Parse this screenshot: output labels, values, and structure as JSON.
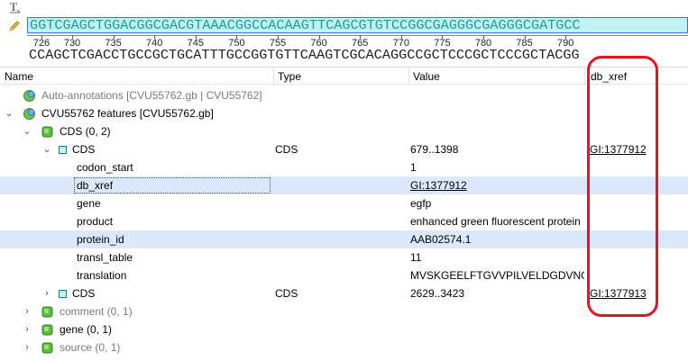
{
  "sequence": {
    "forward": "GGTCGAGCTGGACGGCGACGTAAACGGCCACAAGTTCAGCGTGTCCGGCGAGGGCGAGGGCGATGCC",
    "complement": "CCAGCTCGACCTGCCGCTGCATTTGCCGGTGTTCAAGTCGCACAGGCCGCTCCCGCTCCCGCTACGG",
    "ruler_labels": [
      "726",
      "730",
      "735",
      "740",
      "745",
      "750",
      "755",
      "760",
      "765",
      "770",
      "775",
      "780",
      "785",
      "790"
    ]
  },
  "columns": {
    "name": "Name",
    "type": "Type",
    "value": "Value",
    "db_xref": "db_xref"
  },
  "tree": {
    "auto_annotations": "Auto-annotations [CVU55762.gb | CVU55762]",
    "features": "CVU55762 features [CVU55762.gb]",
    "cds_group": "CDS  (0, 2)",
    "cds1": {
      "name": "CDS",
      "type": "CDS",
      "value": "679..1398",
      "db_xref": "GI:1377912"
    },
    "qualifiers": [
      {
        "name": "codon_start",
        "value": "1"
      },
      {
        "name": "db_xref",
        "value": "GI:1377912"
      },
      {
        "name": "gene",
        "value": "egfp"
      },
      {
        "name": "product",
        "value": "enhanced green fluorescent protein"
      },
      {
        "name": "protein_id",
        "value": "AAB02574.1"
      },
      {
        "name": "transl_table",
        "value": "11"
      },
      {
        "name": "translation",
        "value": "MVSKGEELFTGVVPILVELDGDVNGH..."
      }
    ],
    "cds2": {
      "name": "CDS",
      "type": "CDS",
      "value": "2629..3423",
      "db_xref": "GI:1377913"
    },
    "comment": "comment  (0, 1)",
    "gene": "gene  (0, 1)",
    "source": "source  (0, 1)"
  },
  "colors": {
    "selection": "#d9e9fb",
    "highlight": "#e3161f",
    "sequence_bg": "#bff2f3"
  },
  "icons": [
    "text-tool-icon",
    "pencil-icon",
    "annotation-globe-icon",
    "feature-group-icon",
    "feature-square-icon",
    "chevron-right-icon",
    "chevron-down-icon"
  ]
}
